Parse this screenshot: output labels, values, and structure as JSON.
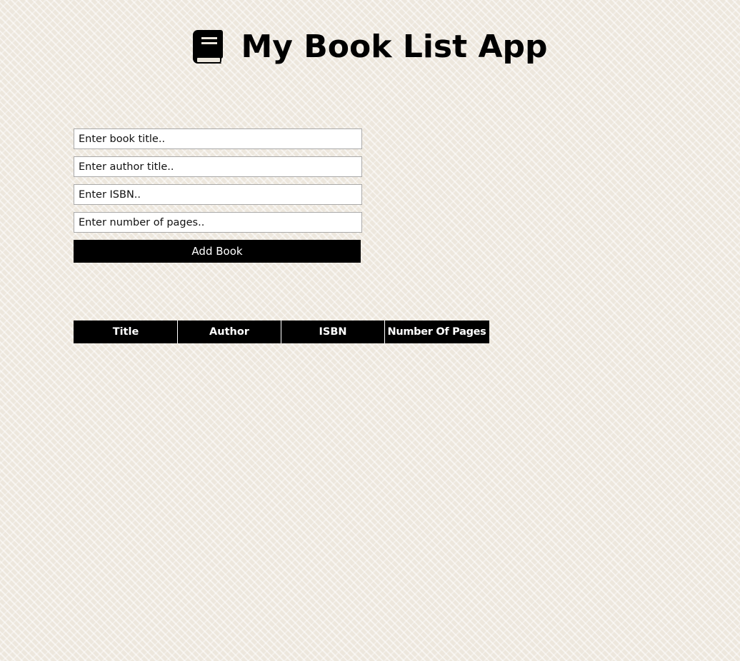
{
  "header": {
    "title": "My Book List App",
    "icon": "book-icon"
  },
  "form": {
    "title_input": {
      "placeholder": "Enter book title..",
      "value": ""
    },
    "author_input": {
      "placeholder": "Enter author title..",
      "value": ""
    },
    "isbn_input": {
      "placeholder": "Enter ISBN..",
      "value": ""
    },
    "pages_input": {
      "placeholder": "Enter number of pages..",
      "value": ""
    },
    "submit_label": "Add Book"
  },
  "table": {
    "columns": [
      "Title",
      "Author",
      "ISBN",
      "Number Of Pages"
    ],
    "rows": []
  },
  "colors": {
    "background": "#ede7dd",
    "accent": "#000000",
    "accent_text": "#ffffff"
  }
}
